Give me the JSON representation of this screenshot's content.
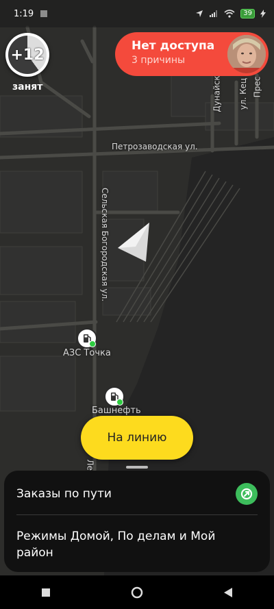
{
  "status_bar": {
    "time": "1:19",
    "battery": "39",
    "icons": [
      "location-icon",
      "signal-icon",
      "wifi-icon",
      "battery-icon",
      "charging-icon"
    ]
  },
  "busy_indicator": {
    "value": "+12",
    "label": "занят"
  },
  "availability": {
    "title": "Нет доступа",
    "subtitle": "3 причины",
    "color": "#f44a3c"
  },
  "map": {
    "streets": {
      "petrozavodskaya": "Петрозаводская ул.",
      "selskaya": "Сельская Богородская ул.",
      "dunay": "Дунайск",
      "kets": "ул. Кец",
      "pres": "Прес",
      "les": "Лес"
    },
    "pois": [
      {
        "name": "АЗС Точка"
      },
      {
        "name": "Башнефть"
      }
    ]
  },
  "online_button": {
    "label": "На линию",
    "color": "#fddb1e"
  },
  "sheet": {
    "row1": "Заказы по пути",
    "row2": "Режимы Домой, По делам и Мой район"
  },
  "nav": [
    "recent-apps",
    "home",
    "back"
  ]
}
